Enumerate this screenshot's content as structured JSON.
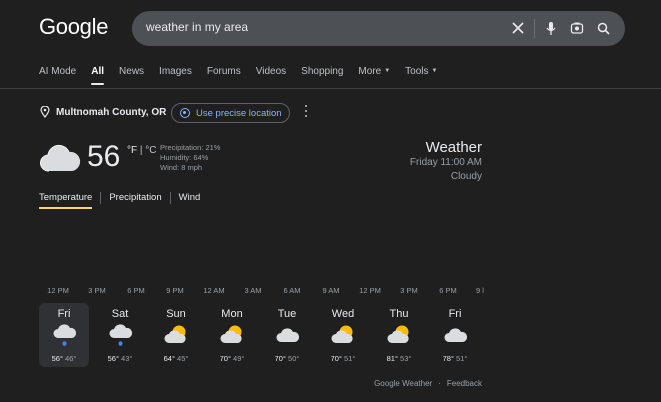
{
  "header": {
    "logo": "Google",
    "search_value": "weather in my area"
  },
  "tabs": [
    {
      "label": "AI Mode"
    },
    {
      "label": "All"
    },
    {
      "label": "News"
    },
    {
      "label": "Images"
    },
    {
      "label": "Forums"
    },
    {
      "label": "Videos"
    },
    {
      "label": "Shopping"
    },
    {
      "label": "More"
    },
    {
      "label": "Tools"
    }
  ],
  "location": {
    "name": "Multnomah County, OR",
    "precise_label": "Use precise location"
  },
  "current": {
    "temp": "56",
    "unit_f": "°F",
    "unit_sep": " | ",
    "unit_c": "°C",
    "precipitation": "Precipitation: 21%",
    "humidity": "Humidity: 64%",
    "wind": "Wind: 8 mph",
    "title": "Weather",
    "time": "Friday 11:00 AM",
    "condition": "Cloudy"
  },
  "subtabs": [
    "Temperature",
    "Precipitation",
    "Wind"
  ],
  "hours": [
    "12 PM",
    "3 PM",
    "6 PM",
    "9 PM",
    "12 AM",
    "3 AM",
    "6 AM",
    "9 AM",
    "12 PM",
    "3 PM",
    "6 PM",
    "9 l"
  ],
  "days": [
    {
      "name": "Fri",
      "hi": "56°",
      "lo": "46°",
      "icon": "cloud-rain-icon"
    },
    {
      "name": "Sat",
      "hi": "56°",
      "lo": "43°",
      "icon": "cloud-rain-icon"
    },
    {
      "name": "Sun",
      "hi": "64°",
      "lo": "45°",
      "icon": "partly-cloudy-icon"
    },
    {
      "name": "Mon",
      "hi": "70°",
      "lo": "49°",
      "icon": "partly-cloudy-icon"
    },
    {
      "name": "Tue",
      "hi": "70°",
      "lo": "50°",
      "icon": "cloud-icon"
    },
    {
      "name": "Wed",
      "hi": "70°",
      "lo": "51°",
      "icon": "partly-cloudy-icon"
    },
    {
      "name": "Thu",
      "hi": "81°",
      "lo": "53°",
      "icon": "partly-cloudy-icon"
    },
    {
      "name": "Fri",
      "hi": "78°",
      "lo": "51°",
      "icon": "cloud-icon"
    }
  ],
  "footer": {
    "source": "Google Weather",
    "sep": "·",
    "feedback": "Feedback"
  },
  "colors": {
    "background": "#1f1f1f",
    "search_bg": "#4d5156",
    "link": "#8ab4f8",
    "active_underline": "#fdd663"
  }
}
